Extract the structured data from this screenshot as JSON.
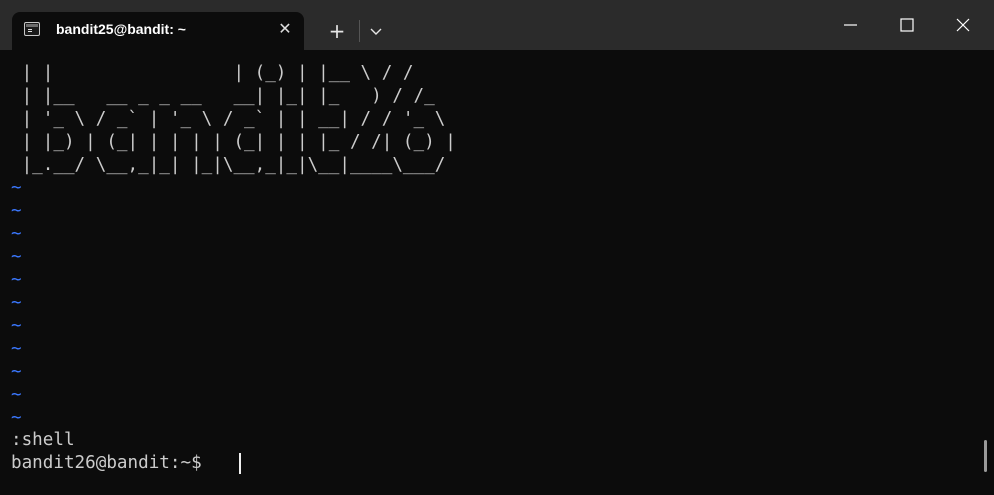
{
  "window": {
    "tab_title": "bandit25@bandit: ~",
    "tab_close_glyph": "✕",
    "new_tab_glyph": "+"
  },
  "terminal": {
    "ascii_art": " | |                 | (_) | |__ \\ / /\n | |__   __ _ _ __   __| |_| |_   ) / /_\n | '_ \\ / _` | '_ \\ / _` | | __| / / '_ \\\n | |_) | (_| | | | | (_| | | |_ / /| (_) |\n |_.__/ \\__,_|_| |_|\\__,_|_|\\__|____\\___/",
    "tilde_lines": [
      "~",
      "~",
      "~",
      "~",
      "~",
      "~",
      "~",
      "~",
      "~",
      "~",
      "~"
    ],
    "command_line": ":shell",
    "prompt": "bandit26@bandit:~$ "
  },
  "colors": {
    "background": "#0c0c0c",
    "titlebar": "#2b2b2b",
    "text": "#cccccc",
    "tilde": "#3b78ff"
  }
}
